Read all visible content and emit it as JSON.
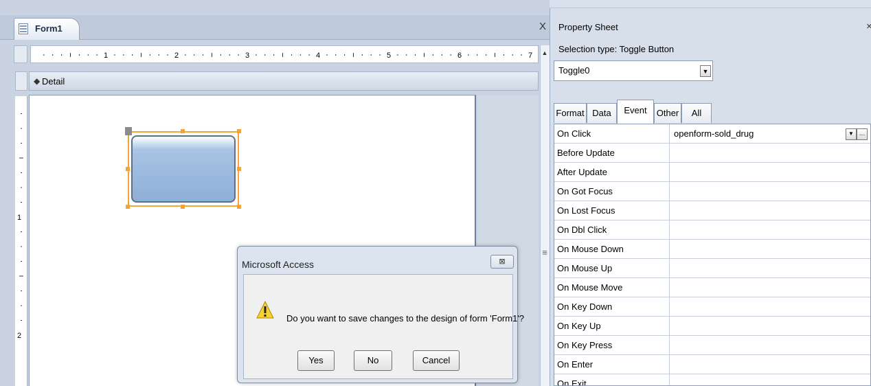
{
  "document": {
    "tab_label": "Form1",
    "close_glyph": "X",
    "section_label": "Detail",
    "ruler_numbers": [
      "1",
      "2",
      "3",
      "4",
      "5",
      "6",
      "7"
    ],
    "vertical_ruler_numbers": [
      "1",
      "2"
    ]
  },
  "dialog": {
    "title": "Microsoft Access",
    "close_glyph": "⊠",
    "message": "Do you want to save changes to the design of form 'Form1'?",
    "buttons": {
      "yes": "Yes",
      "no": "No",
      "cancel": "Cancel"
    },
    "icon": "warning-icon"
  },
  "property_sheet": {
    "title": "Property Sheet",
    "close_glyph": "×",
    "selection_type": "Selection type:  Toggle Button",
    "object_selector": {
      "value": "Toggle0"
    },
    "tabs": [
      {
        "label": "Format",
        "active": false
      },
      {
        "label": "Data",
        "active": false
      },
      {
        "label": "Event",
        "active": true
      },
      {
        "label": "Other",
        "active": false
      },
      {
        "label": "All",
        "active": false
      }
    ],
    "properties": [
      {
        "name": "On Click",
        "value": "openform-sold_drug"
      },
      {
        "name": "Before Update",
        "value": ""
      },
      {
        "name": "After Update",
        "value": ""
      },
      {
        "name": "On Got Focus",
        "value": ""
      },
      {
        "name": "On Lost Focus",
        "value": ""
      },
      {
        "name": "On Dbl Click",
        "value": ""
      },
      {
        "name": "On Mouse Down",
        "value": ""
      },
      {
        "name": "On Mouse Up",
        "value": ""
      },
      {
        "name": "On Mouse Move",
        "value": ""
      },
      {
        "name": "On Key Down",
        "value": ""
      },
      {
        "name": "On Key Up",
        "value": ""
      },
      {
        "name": "On Key Press",
        "value": ""
      },
      {
        "name": "On Enter",
        "value": ""
      },
      {
        "name": "On Exit",
        "value": ""
      }
    ]
  },
  "colors": {
    "selection_handle": "#f2a33a",
    "toggle_face": "#9ab9df"
  }
}
